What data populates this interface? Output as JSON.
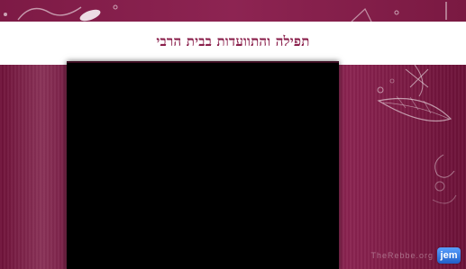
{
  "header": {
    "title": "תפילה והתוועדות בבית הרבי"
  },
  "video": {
    "state": "black"
  },
  "branding": {
    "logo_text": "jem",
    "watermark_text": "TheRebbe.org"
  },
  "colors": {
    "banner": "#7d1a45",
    "title_text": "#8a1f4b",
    "panel": "#8a2350",
    "video_bg": "#000000",
    "logo": "#1f5fc8"
  }
}
